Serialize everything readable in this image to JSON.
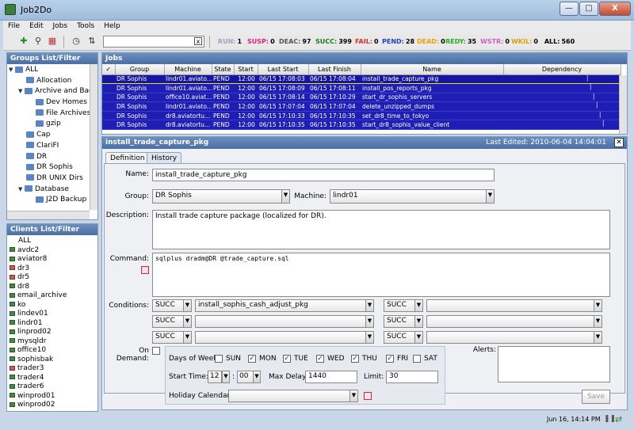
{
  "window": {
    "title": "Job2Do",
    "min": "—",
    "max": "□",
    "close": "X"
  },
  "menu": [
    "File",
    "Edit",
    "Jobs",
    "Tools",
    "Help"
  ],
  "toolbar": {
    "search_value": "",
    "search_clear": "x",
    "statuses": [
      {
        "label": "RUN:",
        "count": "1",
        "color": "#9aa3c2"
      },
      {
        "label": "SUSP:",
        "count": "0",
        "color": "#e0207a"
      },
      {
        "label": "DEAC:",
        "count": "97",
        "color": "#555555"
      },
      {
        "label": "SUCC:",
        "count": "399",
        "color": "#1a7a1a"
      },
      {
        "label": "FAIL:",
        "count": "0",
        "color": "#e03030"
      },
      {
        "label": "PEND:",
        "count": "28",
        "color": "#2040c0"
      },
      {
        "label": "DEAD:",
        "count": "0",
        "color": "#f0a000"
      },
      {
        "label": "REDY:",
        "count": "35",
        "color": "#20b020"
      },
      {
        "label": "WSTR:",
        "count": "0",
        "color": "#d060c0"
      },
      {
        "label": "WKIL:",
        "count": "0",
        "color": "#e0a000"
      },
      {
        "label": "ALL:",
        "count": "560",
        "color": "#000000"
      }
    ]
  },
  "groups": {
    "title": "Groups List/Filter",
    "items": [
      "ALL",
      "Allocation",
      "Archive and Backup",
      "Dev Homes",
      "File Archives",
      "gzip",
      "Cap",
      "ClariFI",
      "DR",
      "DR Sophis",
      "DR UNIX Dirs",
      "Database",
      "J2D Backup"
    ]
  },
  "clients": {
    "title": "Clients List/Filter",
    "items": [
      {
        "name": "ALL",
        "state": "none"
      },
      {
        "name": "avdc2",
        "state": "ok"
      },
      {
        "name": "aviator8",
        "state": "ok"
      },
      {
        "name": "dr3",
        "state": "bad"
      },
      {
        "name": "dr5",
        "state": "bad"
      },
      {
        "name": "dr8",
        "state": "ok"
      },
      {
        "name": "email_archive",
        "state": "ok"
      },
      {
        "name": "ko",
        "state": "ok"
      },
      {
        "name": "lindev01",
        "state": "ok"
      },
      {
        "name": "lindr01",
        "state": "ok"
      },
      {
        "name": "linprod02",
        "state": "ok"
      },
      {
        "name": "mysqldr",
        "state": "ok"
      },
      {
        "name": "office10",
        "state": "ok"
      },
      {
        "name": "sophisbak",
        "state": "ok"
      },
      {
        "name": "trader3",
        "state": "bad"
      },
      {
        "name": "trader4",
        "state": "ok"
      },
      {
        "name": "trader6",
        "state": "ok"
      },
      {
        "name": "winprod01",
        "state": "ok"
      },
      {
        "name": "winprod02",
        "state": "ok"
      }
    ]
  },
  "jobs": {
    "title": "Jobs",
    "columns": [
      "",
      "Group",
      "Machine",
      "State",
      "Start",
      "Last Start",
      "Last Finish",
      "Name",
      "Dependency"
    ],
    "rows": [
      [
        "DR Sophis",
        "lindr01.aviato...",
        "PEND",
        "12:00",
        "06/15 17:08:03",
        "06/15 17:08:04",
        "install_trade_capture_pkg"
      ],
      [
        "DR Sophis",
        "lindr01.aviato...",
        "PEND",
        "12:00",
        "06/15 17:08:09",
        "06/15 17:08:11",
        "install_pos_reports_pkg"
      ],
      [
        "DR Sophis",
        "office10.aviat...",
        "PEND",
        "12:00",
        "06/15 17:08:14",
        "06/15 17:10:29",
        "start_dr_sophis_servers"
      ],
      [
        "DR Sophis",
        "lindr01.aviato...",
        "PEND",
        "12:00",
        "06/15 17:07:04",
        "06/15 17:07:04",
        "delete_unzipped_dumps"
      ],
      [
        "DR Sophis",
        "dr8.aviatortu...",
        "PEND",
        "12:00",
        "06/15 17:10:33",
        "06/15 17:10:35",
        "set_dr8_time_to_tokyo"
      ],
      [
        "DR Sophis",
        "dr8.aviatortu...",
        "PEND",
        "12:00",
        "06/15 17:10:35",
        "06/15 17:10:35",
        "start_dr8_sophis_value_client"
      ]
    ]
  },
  "detail": {
    "title": "install_trade_capture_pkg",
    "last_edited": "Last Edited:  2010-06-04 14:04:01",
    "tabs": [
      "Definition",
      "History"
    ],
    "name_label": "Name:",
    "name_value": "install_trade_capture_pkg",
    "group_label": "Group:",
    "group_value": "DR Sophis",
    "machine_label": "Machine:",
    "machine_value": "lindr01",
    "description_label": "Description:",
    "description_value": "Install trade capture package (localized for DR).",
    "command_label": "Command:",
    "command_value": "sqlplus dradm@DR @trade_capture.sql",
    "conditions_label": "Conditions:",
    "conditions": [
      {
        "status": "SUCC",
        "job": "install_sophis_cash_adjust_pkg"
      },
      {
        "status": "SUCC",
        "job": ""
      },
      {
        "status": "SUCC",
        "job": ""
      },
      {
        "status": "SUCC",
        "job": ""
      },
      {
        "status": "SUCC",
        "job": ""
      },
      {
        "status": "SUCC",
        "job": ""
      }
    ],
    "on_demand_label": "On Demand:",
    "days_label": "Days of Week:",
    "days": [
      {
        "name": "SUN",
        "checked": false
      },
      {
        "name": "MON",
        "checked": true
      },
      {
        "name": "TUE",
        "checked": true
      },
      {
        "name": "WED",
        "checked": true
      },
      {
        "name": "THU",
        "checked": true
      },
      {
        "name": "FRI",
        "checked": true
      },
      {
        "name": "SAT",
        "checked": false
      }
    ],
    "start_time_label": "Start Time:",
    "start_hour": "12",
    "start_min": "00",
    "max_delay_label": "Max Delay:",
    "max_delay_value": "1440",
    "limit_label": "Limit:",
    "limit_value": "30",
    "holiday_label": "Holiday Calendar:",
    "holiday_value": "",
    "alerts_label": "Alerts:",
    "save_label": "Save"
  },
  "status": {
    "datetime": "Jun 16, 14:14 PM"
  }
}
